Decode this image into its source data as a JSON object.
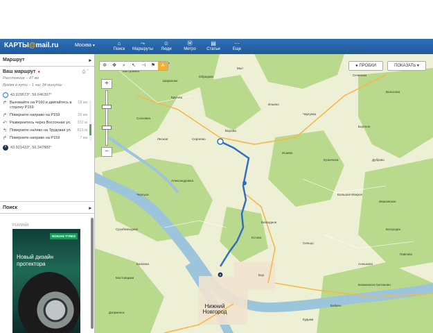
{
  "header": {
    "logo_brand": "КАРТЫ",
    "logo_at": "@",
    "logo_rest": "mail.ru",
    "city": "Москва",
    "nav": [
      {
        "label": "Поиск",
        "icon": "home-icon"
      },
      {
        "label": "Маршруты",
        "icon": "route-icon"
      },
      {
        "label": "Люди",
        "icon": "people-icon"
      },
      {
        "label": "Метро",
        "icon": "metro-icon"
      },
      {
        "label": "Статьи",
        "icon": "articles-icon"
      },
      {
        "label": "Еще",
        "icon": "more-icon"
      }
    ]
  },
  "sidebar": {
    "route_section": "Маршрут",
    "route_title": "Ваш маршрут",
    "distance": "Расстояние – 47 км",
    "time": "Время в пути – 1 час 34 минуты",
    "start": "43.929673°, 56.646397°",
    "steps": [
      {
        "text": "Выезжайте на Р160 и двигайтесь в сторону Р159",
        "dist": "18 км"
      },
      {
        "text": "Поверните направо на Р159",
        "dist": "26 км"
      },
      {
        "text": "Развернитесь через Восточная ул.",
        "dist": "312 м"
      },
      {
        "text": "Поверните налево на Трудовая ул.",
        "dist": "813 м"
      },
      {
        "text": "Поверните направо на Р159",
        "dist": "7 км"
      }
    ],
    "end": "43.921433°, 56.347882°",
    "search_section": "Поиск",
    "ad_label": "РЕКЛАМА",
    "ad_brand": "NOKIAN TYRES",
    "ad_text": "Новый дизайн протектора"
  },
  "map": {
    "btn_probki": "ПРОБКИ",
    "btn_show": "ПОКАЗАТЬ",
    "city": "Нижний Новгород",
    "labels": [
      "Бастраково",
      "Пустынь",
      "Обрадово",
      "Шарапово",
      "Мыт",
      "Сеченово",
      "Волосово",
      "Чиргуево",
      "Ильино",
      "Бортное",
      "Сосновка",
      "Кругово",
      "Лесная",
      "Сергеево",
      "Исаево",
      "Кузнечиха",
      "Ворсма",
      "Кстово",
      "Большое Мокрое",
      "Богородск",
      "Павлово",
      "Алешково",
      "Сухобезводное",
      "Дзержинск",
      "Бор",
      "Кудьма",
      "Балахна",
      "Бабино",
      "Александровка",
      "Безводное",
      "Чернуха",
      "Сельцо",
      "Ивановское",
      "Дуброво",
      "Мостовщики",
      "Ближнеконстантиново"
    ]
  },
  "colors": {
    "header_bg": "#1f5a9c",
    "route_line": "#2e6fc2",
    "forest": "#b9d98c",
    "water": "#9cc5dc"
  }
}
